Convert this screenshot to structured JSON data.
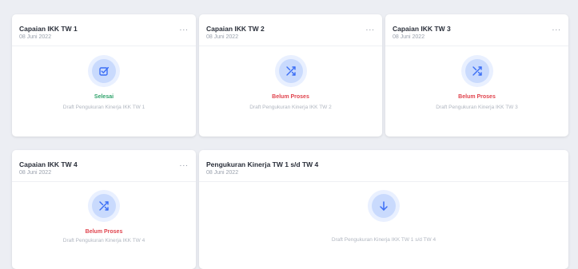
{
  "cards": [
    {
      "title": "Capaian IKK TW 1",
      "date": "08 Juni 2022",
      "status": "Selesai",
      "description": "Draft Pengukuran Kinerja IKK TW 1",
      "icon": "check-square-icon"
    },
    {
      "title": "Capaian IKK TW 2",
      "date": "08 Juni 2022",
      "status": "Belum Proses",
      "description": "Draft Pengukuran Kinerja IKK TW 2",
      "icon": "shuffle-icon"
    },
    {
      "title": "Capaian IKK TW 3",
      "date": "08 Juni 2022",
      "status": "Belum Proses",
      "description": "Draft Pengukuran Kinerja IKK TW 3",
      "icon": "shuffle-icon"
    },
    {
      "title": "Capaian IKK TW 4",
      "date": "08 Juni 2022",
      "status": "Belum Proses",
      "description": "Draft Pengukuran Kinerja IKK TW 4",
      "icon": "shuffle-icon"
    },
    {
      "title": "Pengukuran Kinerja TW 1 s/d TW 4",
      "date": "08 Juni 2022",
      "description": "Draft Pengukuran Kinerja IKK TW 1 s/d TW 4",
      "icon": "arrow-down-icon"
    }
  ],
  "more_label": "···",
  "colors": {
    "accent": "#3b6ef5",
    "done": "#2fa36b",
    "pending": "#e0434d"
  }
}
